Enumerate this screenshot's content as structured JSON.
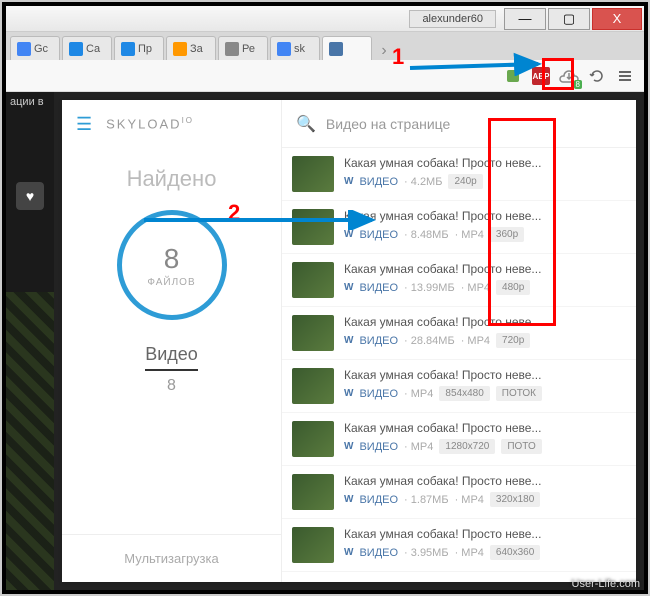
{
  "window": {
    "user": "alexunder60",
    "min": "—",
    "max": "▢",
    "close": "X"
  },
  "tabs": [
    {
      "label": "Gc",
      "fav": "#4285f4"
    },
    {
      "label": "Ca",
      "fav": "#1e88e5"
    },
    {
      "label": "Пр",
      "fav": "#1e88e5"
    },
    {
      "label": "За",
      "fav": "#ff9800"
    },
    {
      "label": "Ре",
      "fav": "#888"
    },
    {
      "label": "sk",
      "fav": "#4285f4"
    },
    {
      "label": "",
      "fav": "#4a76a8",
      "active": true
    }
  ],
  "left": {
    "caption": "ации в"
  },
  "skyload": {
    "brand": "SKYLOAD",
    "brandSup": "IO",
    "found": "Найдено",
    "circleNum": "8",
    "circleLbl": "ФАЙЛОВ",
    "cat": "Видео",
    "catNum": "8",
    "multi": "Мультизагрузка",
    "searchPlaceholder": "Видео на странице"
  },
  "items": [
    {
      "title": "Какая умная собака! Просто неве...",
      "src": "ВИДЕО",
      "size": "4.2МБ",
      "fmt": "",
      "badge": "240p"
    },
    {
      "title": "Какая умная собака! Просто неве...",
      "src": "ВИДЕО",
      "size": "8.48МБ",
      "fmt": "MP4",
      "badge": "360p"
    },
    {
      "title": "Какая умная собака! Просто неве...",
      "src": "ВИДЕО",
      "size": "13.99МБ",
      "fmt": "MP4",
      "badge": "480p"
    },
    {
      "title": "Какая умная собака! Просто неве...",
      "src": "ВИДЕО",
      "size": "28.84МБ",
      "fmt": "MP4",
      "badge": "720p"
    },
    {
      "title": "Какая умная собака! Просто неве...",
      "src": "ВИДЕО",
      "size": "",
      "fmt": "MP4",
      "badge": "854x480",
      "badge2": "ПОТОК"
    },
    {
      "title": "Какая умная собака! Просто неве...",
      "src": "ВИДЕО",
      "size": "",
      "fmt": "MP4",
      "badge": "1280x720",
      "badge2": "ПОТО"
    },
    {
      "title": "Какая умная собака! Просто неве...",
      "src": "ВИДЕО",
      "size": "1.87МБ",
      "fmt": "MP4",
      "badge": "320x180"
    },
    {
      "title": "Какая умная собака! Просто неве...",
      "src": "ВИДЕО",
      "size": "3.95МБ",
      "fmt": "MP4",
      "badge": "640x360"
    }
  ],
  "anno": {
    "n1": "1",
    "n2": "2"
  },
  "watermark": "User-Life.com"
}
